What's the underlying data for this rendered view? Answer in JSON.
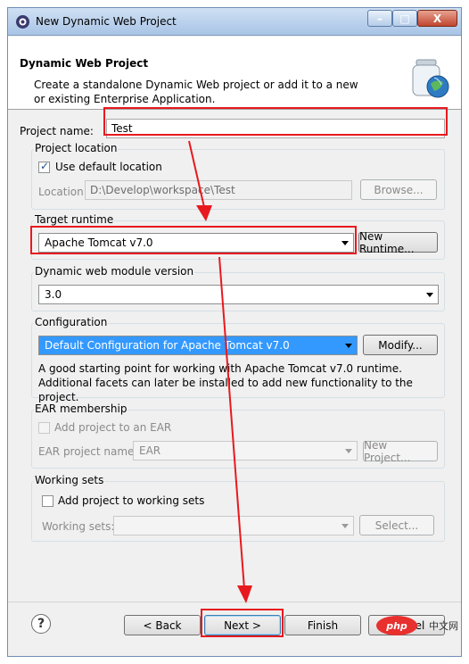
{
  "window": {
    "title": "New Dynamic Web Project",
    "minimize": "–",
    "maximize": "□",
    "close": "X"
  },
  "header": {
    "title": "Dynamic Web Project",
    "description": "Create a standalone Dynamic Web project or add it to a new or existing Enterprise Application."
  },
  "project_name": {
    "label": "Project name:",
    "value": "Test"
  },
  "project_location": {
    "title": "Project location",
    "use_default_label": "Use default location",
    "use_default_checked": true,
    "location_label": "Location:",
    "location_value": "D:\\Develop\\workspace\\Test",
    "browse_label": "Browse..."
  },
  "target_runtime": {
    "title": "Target runtime",
    "value": "Apache Tomcat v7.0",
    "new_runtime_label": "New Runtime..."
  },
  "module_version": {
    "title": "Dynamic web module version",
    "value": "3.0"
  },
  "configuration": {
    "title": "Configuration",
    "value": "Default Configuration for Apache Tomcat v7.0",
    "modify_label": "Modify...",
    "description": "A good starting point for working with Apache Tomcat v7.0 runtime. Additional facets can later be installed to add new functionality to the project."
  },
  "ear": {
    "title": "EAR membership",
    "add_label": "Add project to an EAR",
    "name_label": "EAR project name:",
    "name_value": "EAR",
    "new_project_label": "New Project..."
  },
  "working_sets": {
    "title": "Working sets",
    "add_label": "Add project to working sets",
    "sets_label": "Working sets:",
    "select_label": "Select..."
  },
  "footer": {
    "help": "?",
    "back": "< Back",
    "next": "Next >",
    "finish": "Finish",
    "cancel": "Cancel"
  },
  "watermark": {
    "logo": "php",
    "text": "中文网"
  },
  "colors": {
    "highlight": "#e8191e",
    "selection": "#3399ff"
  }
}
